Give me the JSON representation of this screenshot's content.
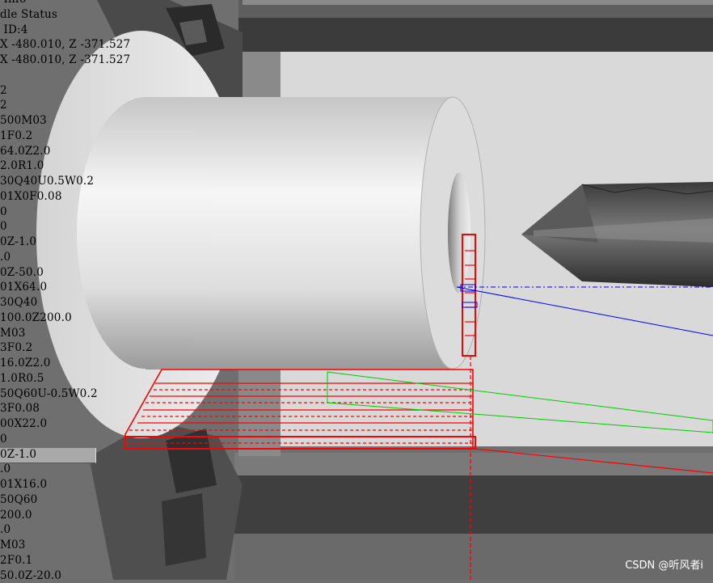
{
  "info_lines": [
    " Info",
    "dle Status",
    " ID:4",
    "X -480.010, Z -371.527",
    "X -480.010, Z -371.527"
  ],
  "program_lines": [
    "2",
    "2",
    "500M03",
    "1F0.2",
    "64.0Z2.0",
    "2.0R1.0",
    "30Q40U0.5W0.2",
    "01X0F0.08",
    "0",
    "0",
    "0Z-1.0",
    ".0",
    "0Z-50.0",
    "01X64.0",
    "30Q40",
    "100.0Z200.0",
    "M03",
    "3F0.2",
    "16.0Z2.0",
    "1.0R0.5",
    "50Q60U-0.5W0.2",
    "3F0.08",
    "00X22.0",
    "0",
    "0Z-1.0",
    ".0",
    "01X16.0",
    "50Q60",
    "200.0",
    ".0",
    "M03",
    "2F0.1",
    "50.0Z-20.0"
  ],
  "highlighted_line_index": 24,
  "watermark": "CSDN @听风者i",
  "colors": {
    "background": "#6f6f6f",
    "workpiece": "#d9d9d9",
    "toolpath": "#ff0000",
    "axis_x": "#0000ff",
    "axis_z": "#00cc00"
  }
}
